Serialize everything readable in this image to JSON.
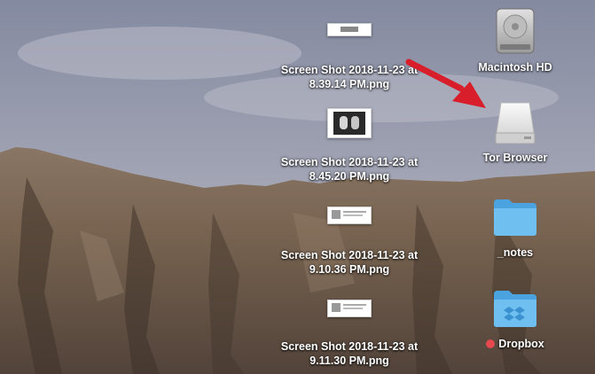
{
  "desktop": {
    "files": [
      {
        "line1": "Screen Shot 2018-11-23 at",
        "line2": "8.39.14 PM.png"
      },
      {
        "line1": "Screen Shot 2018-11-23 at",
        "line2": "8.45.20 PM.png"
      },
      {
        "line1": "Screen Shot 2018-11-23 at",
        "line2": "9.10.36 PM.png"
      },
      {
        "line1": "Screen Shot 2018-11-23 at",
        "line2": "9.11.30 PM.png"
      }
    ],
    "volumes": [
      {
        "label": "Macintosh HD",
        "icon": "hard-drive-icon"
      },
      {
        "label": "Tor Browser",
        "icon": "removable-disk-icon"
      }
    ],
    "folders": [
      {
        "label": "_notes",
        "icon": "folder-icon"
      },
      {
        "label": "Dropbox",
        "icon": "dropbox-folder-icon",
        "tag_color": "#e5484d"
      }
    ],
    "annotation_arrow_color": "#d81e2a"
  }
}
